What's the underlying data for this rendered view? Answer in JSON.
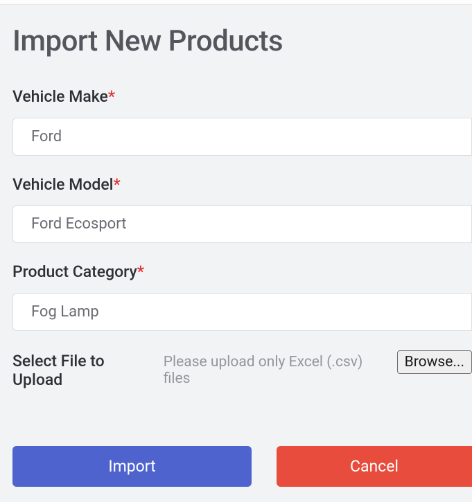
{
  "title": "Import New Products",
  "fields": {
    "vehicle_make": {
      "label": "Vehicle Make",
      "required": "*",
      "value": "Ford"
    },
    "vehicle_model": {
      "label": "Vehicle Model",
      "required": "*",
      "value": "Ford Ecosport"
    },
    "product_category": {
      "label": "Product Category",
      "required": "*",
      "value": "Fog Lamp"
    }
  },
  "file_upload": {
    "label": "Select File to Upload",
    "hint": "Please upload only Excel (.csv) files",
    "browse_label": "Browse..."
  },
  "buttons": {
    "import": "Import",
    "cancel": "Cancel"
  }
}
